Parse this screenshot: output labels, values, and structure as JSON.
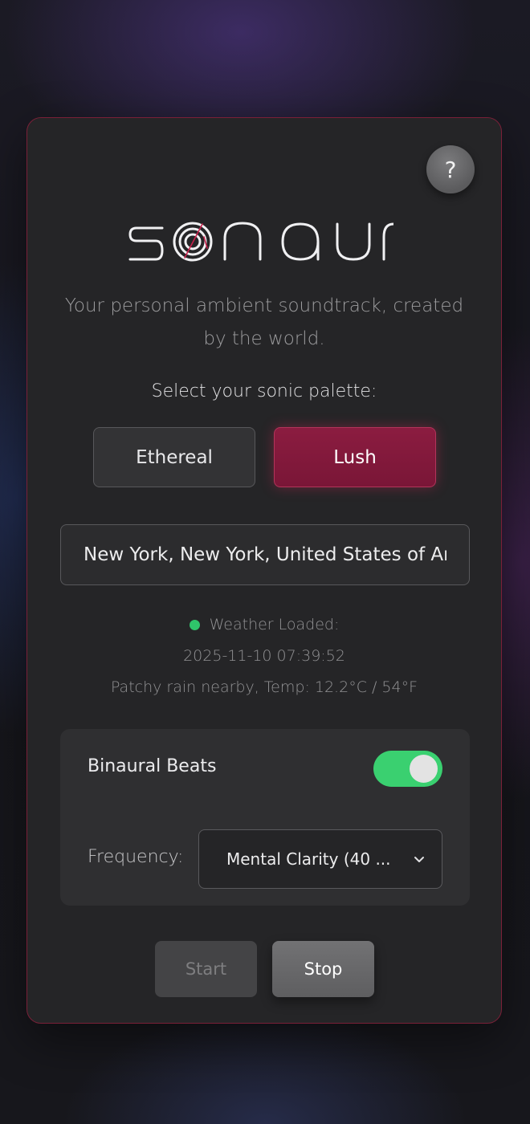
{
  "app": {
    "logo_text": "sonaur",
    "help_label": "?",
    "subtitle": "Your personal ambient soundtrack, created by the world."
  },
  "palette": {
    "label": "Select your sonic palette:",
    "options": [
      {
        "label": "Ethereal",
        "selected": false
      },
      {
        "label": "Lush",
        "selected": true
      }
    ],
    "accent_color": "#8b1c40"
  },
  "location": {
    "value": "New York, New York, United States of America"
  },
  "weather": {
    "status": "Weather Loaded:",
    "status_color": "#2fc46a",
    "timestamp": "2025-11-10 07:39:52",
    "summary": "Patchy rain nearby, Temp: 12.2°C / 54°F"
  },
  "binaural": {
    "label": "Binaural Beats",
    "enabled": true,
    "toggle_color": "#3ad070",
    "frequency_label": "Frequency:",
    "frequency_value": "Mental Clarity (40 ..."
  },
  "controls": {
    "start_label": "Start",
    "stop_label": "Stop"
  }
}
